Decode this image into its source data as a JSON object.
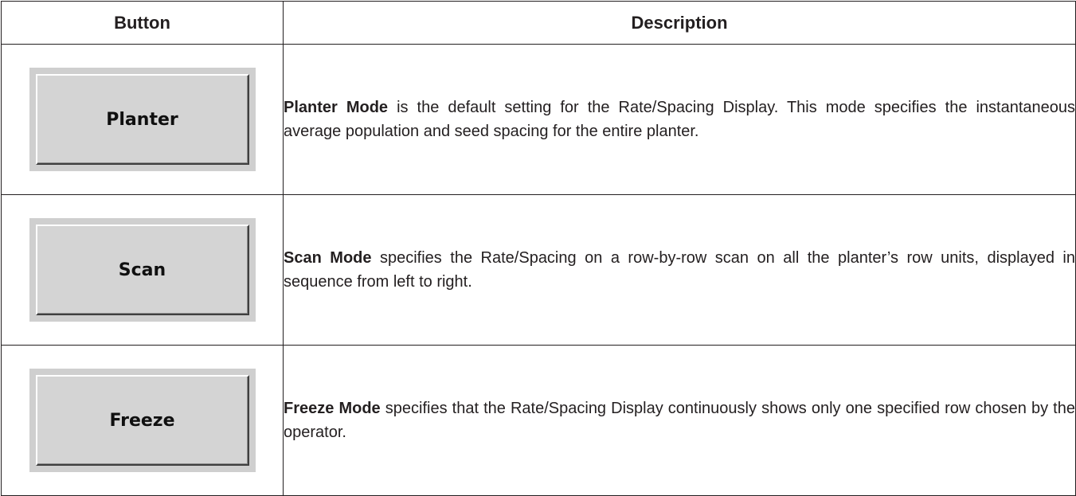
{
  "header": {
    "button_col": "Button",
    "description_col": "Description"
  },
  "rows": [
    {
      "button_label": "Planter",
      "mode_name": "Planter Mode",
      "description": " is the default setting for the Rate/Spacing Display. This mode specifies the instantaneous average population and seed spacing for the entire planter."
    },
    {
      "button_label": "Scan",
      "mode_name": "Scan Mode",
      "description": " specifies the Rate/Spacing on a row-by-row scan on all the planter’s row units, displayed in sequence from left to right."
    },
    {
      "button_label": "Freeze",
      "mode_name": "Freeze Mode",
      "description": " specifies that the Rate/Spacing Display continuously shows only one specified row chosen by the operator."
    }
  ],
  "colors": {
    "button_face": "#d4d4d4",
    "button_frame": "#cfcfcf",
    "rule": "#231f20"
  }
}
